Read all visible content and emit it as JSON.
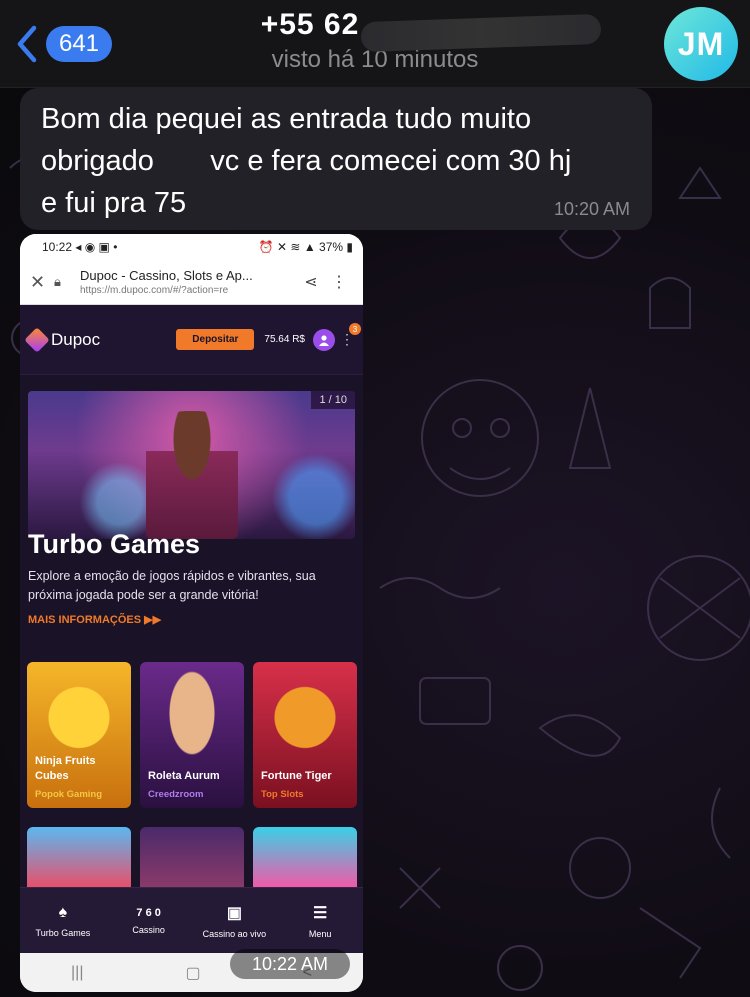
{
  "header": {
    "back_count": "641",
    "contact_name": "+55 62",
    "contact_status": "visto há 10 minutos",
    "avatar_initials": "JM"
  },
  "message": {
    "text": "Bom dia pequei as entrada tudo muito obrigado vc e fera comecei com 30 hj e fui pra 75",
    "line1": "Bom dia pequei as entrada tudo muito",
    "line2": "obrigado       vc e fera comecei com 30 hj",
    "line3": "e fui pra 75",
    "time": "10:20 AM"
  },
  "photo": {
    "time": "10:22 AM",
    "phone_status": {
      "time": "10:22",
      "battery": "37%"
    },
    "browser": {
      "page_title": "Dupoc - Cassino, Slots e Ap...",
      "url": "https://m.dupoc.com/#/?action=re"
    },
    "site": {
      "logo": "Dupoc",
      "deposit_label": "Depositar",
      "balance": "75.64 R$",
      "notif_count": "3",
      "slide_counter": "1 / 10",
      "hero_title": "Turbo Games",
      "hero_desc": "Explore a emoção de jogos rápidos e vibrantes, sua próxima jogada pode ser a grande vitória!",
      "more_info": "MAIS INFORMAÇÕES ▶▶",
      "games": [
        {
          "name": "Ninja Fruits Cubes",
          "provider": "Popok Gaming",
          "provider_color": "#f5c842"
        },
        {
          "name": "Roleta Aurum",
          "provider": "Creedzroom",
          "provider_color": "#b07cf0"
        },
        {
          "name": "Fortune Tiger",
          "provider": "Top Slots",
          "provider_color": "#f07a2a"
        }
      ],
      "nav": [
        {
          "label": "Turbo Games",
          "icon": "♠"
        },
        {
          "label": "Cassino",
          "icon": "7 6 0"
        },
        {
          "label": "Cassino ao vivo",
          "icon": "▣"
        },
        {
          "label": "Menu",
          "icon": "☰"
        }
      ]
    }
  }
}
